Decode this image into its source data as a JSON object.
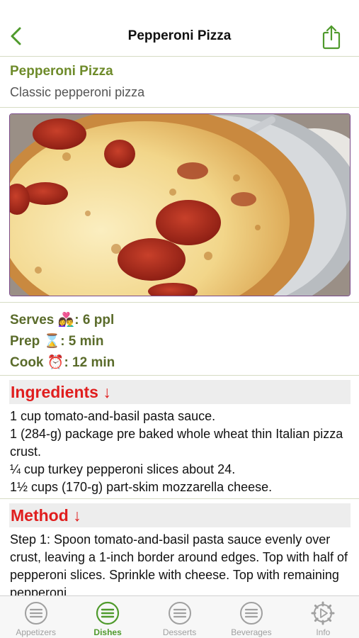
{
  "nav": {
    "title": "Pepperoni Pizza",
    "back_icon": "chevron-left-icon",
    "share_icon": "share-icon",
    "accent": "#4f9a2c"
  },
  "recipe": {
    "name": "Pepperoni Pizza",
    "subtitle": "Classic pepperoni pizza"
  },
  "stats": {
    "serves_label": "Serves",
    "serves_emoji": "👩‍❤️‍👨",
    "serves_value": ": 6 ppl",
    "prep_label": "Prep",
    "prep_emoji": "⌛",
    "prep_value": ": 5 min",
    "cook_label": "Cook",
    "cook_emoji": "⏰",
    "cook_value": ": 12 min"
  },
  "ingredients": {
    "heading": "Ingredients ↓",
    "items": [
      "1 cup tomato-and-basil pasta sauce.",
      "1 (284-g) package pre baked whole wheat thin Italian pizza crust.",
      "¼ cup turkey pepperoni slices about 24.",
      "1½ cups (170-g) part-skim mozzarella cheese."
    ]
  },
  "method": {
    "heading": "Method ↓",
    "text": "Step 1: Spoon tomato-and-basil pasta sauce evenly over crust, leaving a 1-inch border around edges. Top with half of pepperoni slices. Sprinkle with cheese. Top with remaining pepperoni."
  },
  "tabs": [
    {
      "label": "Appetizers",
      "icon": "list-icon",
      "active": false
    },
    {
      "label": "Dishes",
      "icon": "list-icon",
      "active": true
    },
    {
      "label": "Desserts",
      "icon": "list-icon",
      "active": false
    },
    {
      "label": "Beverages",
      "icon": "list-icon",
      "active": false
    },
    {
      "label": "Info",
      "icon": "gear-icon",
      "active": false
    }
  ],
  "colors": {
    "title_green": "#6e8b2a",
    "stats_olive": "#5a6b2a",
    "section_red": "#e01e1e",
    "tab_active": "#4f9a2c",
    "tab_inactive": "#a0a0a0"
  }
}
